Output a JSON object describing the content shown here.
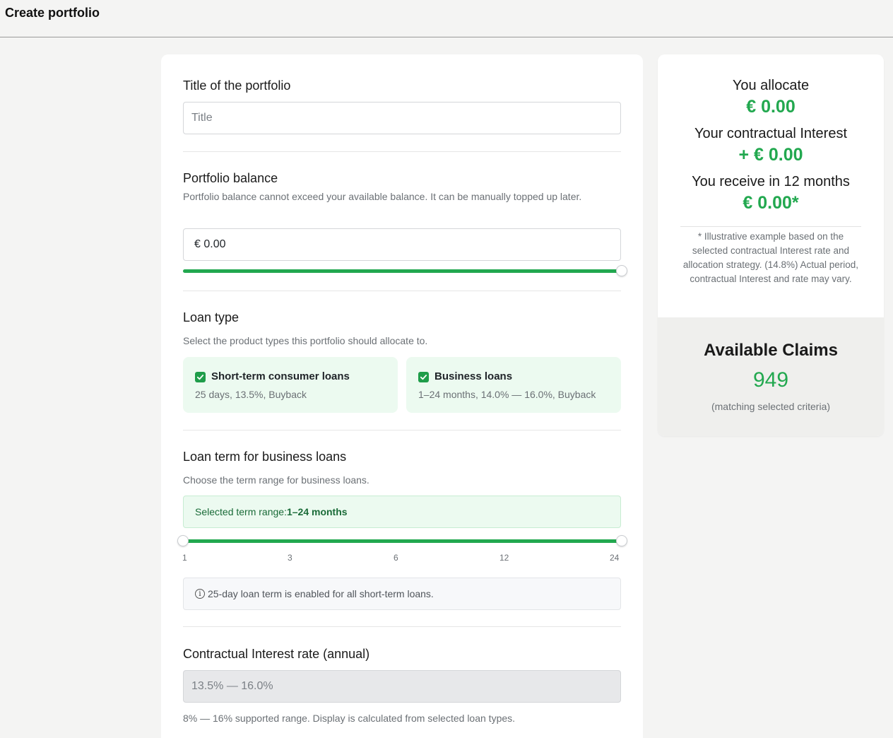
{
  "header": {
    "title": "Create portfolio"
  },
  "portfolio_title": {
    "label": "Title of the portfolio",
    "placeholder": "Title",
    "value": ""
  },
  "balance": {
    "label": "Portfolio balance",
    "description": "Portfolio balance cannot exceed your available balance. It can be manually topped up later.",
    "value": "€ 0.00",
    "slider_fraction": 1.0
  },
  "loan_type": {
    "label": "Loan type",
    "description": "Select the product types this portfolio should allocate to.",
    "options": [
      {
        "name": "Short-term consumer loans",
        "meta": "25 days, 13.5%, Buyback",
        "checked": true
      },
      {
        "name": "Business loans",
        "meta": "1–24 months, 14.0% — 16.0%, Buyback",
        "checked": true
      }
    ]
  },
  "loan_term": {
    "label": "Loan term for business loans",
    "description": "Choose the term range for business loans.",
    "selected_prefix": "Selected term range:",
    "selected_value": "1–24 months",
    "ticks": [
      "1",
      "3",
      "6",
      "12",
      "24"
    ],
    "range_min_index": 0,
    "range_max_index": 4,
    "info": "25-day loan term is enabled for all short-term loans."
  },
  "interest": {
    "label": "Contractual Interest rate (annual)",
    "value": "13.5% — 16.0%",
    "note": "8% — 16% supported range. Display is calculated from selected loan types."
  },
  "summary": {
    "allocate_label": "You allocate",
    "allocate_value": "€ 0.00",
    "interest_label": "Your contractual Interest",
    "interest_value": "+ € 0.00",
    "receive_label": "You receive in 12 months",
    "receive_value": "€ 0.00*",
    "note": "* Illustrative example based on the selected contractual Interest rate and allocation strategy. (14.8%) Actual period, contractual Interest and rate may vary."
  },
  "claims": {
    "title": "Available Claims",
    "count": "949",
    "subtitle": "(matching selected criteria)"
  },
  "colors": {
    "accent": "#22a84f",
    "accent_bg": "#ecfaf0",
    "page_bg": "#f4f4f3"
  }
}
